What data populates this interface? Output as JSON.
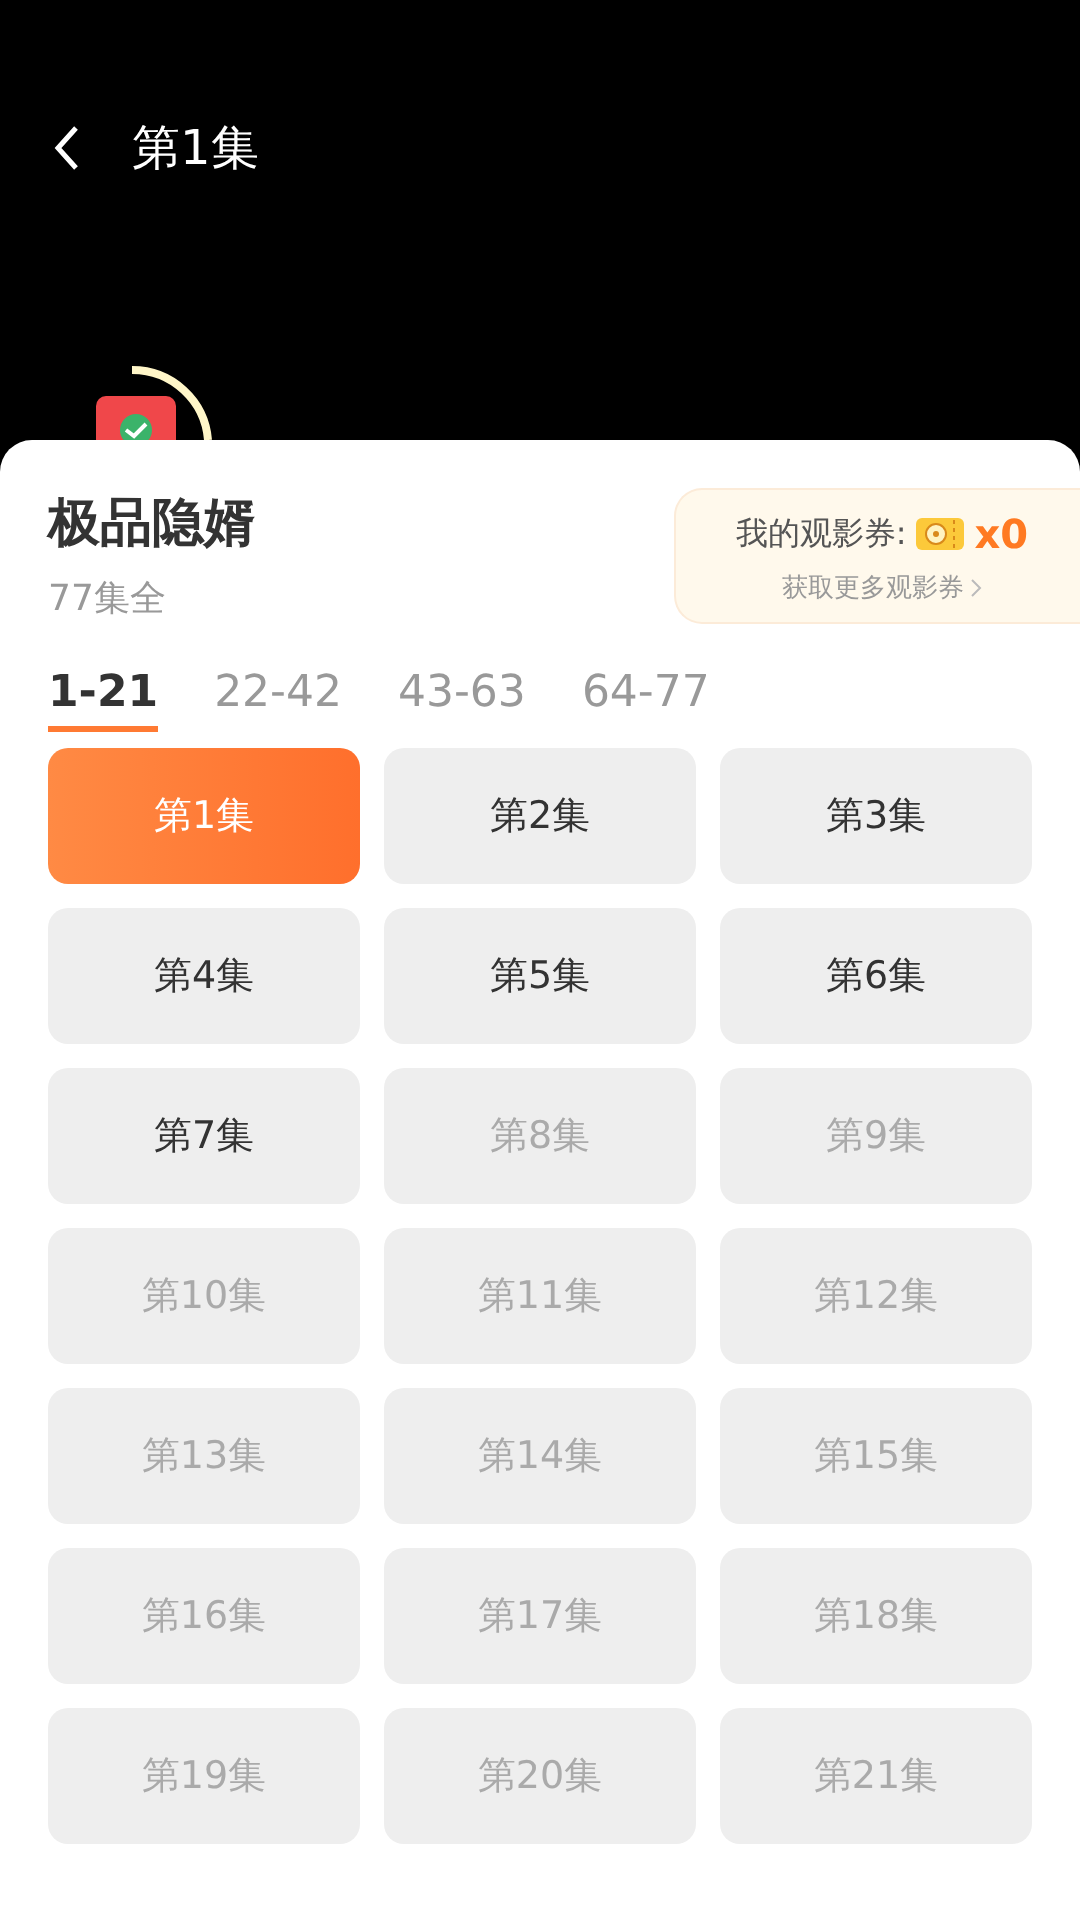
{
  "header": {
    "title": "第1集"
  },
  "drama": {
    "title": "极品隐婿",
    "subtitle": "77集全"
  },
  "coupon": {
    "label": "我的观影券:",
    "count": "x0",
    "link": "获取更多观影券"
  },
  "tabs": [
    {
      "label": "1-21",
      "selected": true
    },
    {
      "label": "22-42",
      "selected": false
    },
    {
      "label": "43-63",
      "selected": false
    },
    {
      "label": "64-77",
      "selected": false
    }
  ],
  "episodes": [
    {
      "label": "第1集",
      "selected": true,
      "locked": false
    },
    {
      "label": "第2集",
      "selected": false,
      "locked": false
    },
    {
      "label": "第3集",
      "selected": false,
      "locked": false
    },
    {
      "label": "第4集",
      "selected": false,
      "locked": false
    },
    {
      "label": "第5集",
      "selected": false,
      "locked": false
    },
    {
      "label": "第6集",
      "selected": false,
      "locked": false
    },
    {
      "label": "第7集",
      "selected": false,
      "locked": false
    },
    {
      "label": "第8集",
      "selected": false,
      "locked": true
    },
    {
      "label": "第9集",
      "selected": false,
      "locked": true
    },
    {
      "label": "第10集",
      "selected": false,
      "locked": true
    },
    {
      "label": "第11集",
      "selected": false,
      "locked": true
    },
    {
      "label": "第12集",
      "selected": false,
      "locked": true
    },
    {
      "label": "第13集",
      "selected": false,
      "locked": true
    },
    {
      "label": "第14集",
      "selected": false,
      "locked": true
    },
    {
      "label": "第15集",
      "selected": false,
      "locked": true
    },
    {
      "label": "第16集",
      "selected": false,
      "locked": true
    },
    {
      "label": "第17集",
      "selected": false,
      "locked": true
    },
    {
      "label": "第18集",
      "selected": false,
      "locked": true
    },
    {
      "label": "第19集",
      "selected": false,
      "locked": true
    },
    {
      "label": "第20集",
      "selected": false,
      "locked": true
    },
    {
      "label": "第21集",
      "selected": false,
      "locked": true
    }
  ]
}
